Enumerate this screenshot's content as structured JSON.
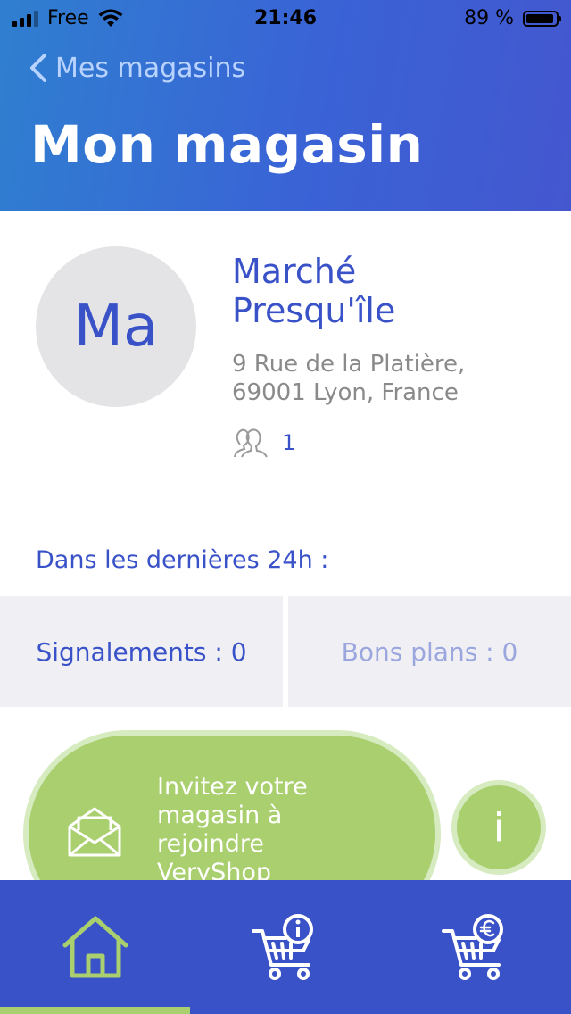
{
  "status_bar": {
    "carrier": "Free",
    "time": "21:46",
    "battery": "89 %"
  },
  "header": {
    "back_label": "Mes magasins",
    "title": "Mon magasin"
  },
  "store": {
    "initials": "Ma",
    "name_line1": "Marché",
    "name_line2": "Presqu'île",
    "address_line1": "9 Rue de la Platière,",
    "address_line2": "69001 Lyon, France",
    "members_count": "1"
  },
  "stats": {
    "period_label": "Dans les dernières 24h :",
    "reports": "Signalements : 0",
    "deals": "Bons plans : 0"
  },
  "invite": {
    "lines": [
      "Invitez votre",
      "magasin à",
      "rejoindre",
      "VeryShop"
    ]
  },
  "info_button": {
    "label": "i"
  },
  "colors": {
    "primary": "#3a52c8",
    "accent_green": "#a9cf6e",
    "header_gradient_start": "#2f7fd0",
    "header_gradient_end": "#4457cf"
  },
  "tabs": {
    "active_index": 0,
    "icons": [
      "home-icon",
      "cart-info-icon",
      "cart-euro-icon"
    ]
  }
}
